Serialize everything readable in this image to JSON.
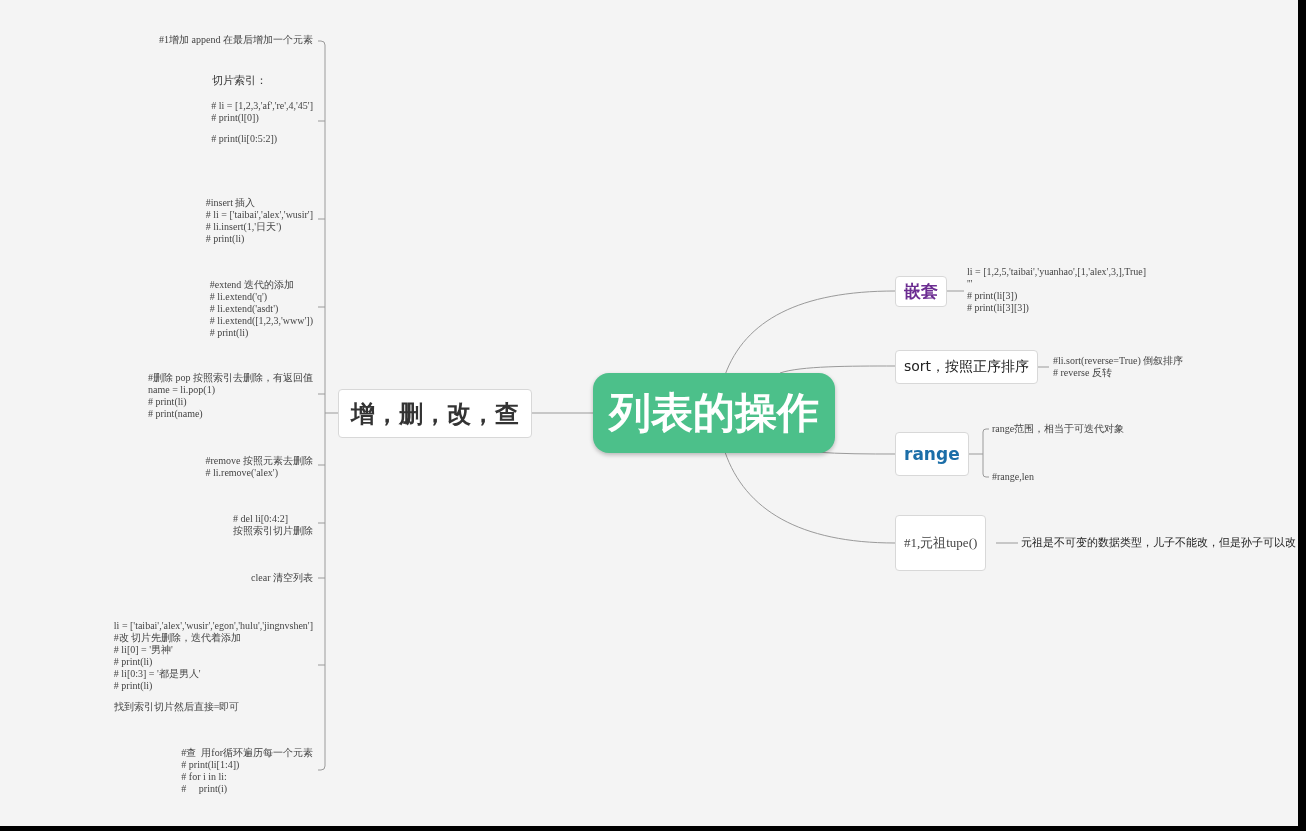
{
  "central_topic": {
    "label": "列表的操作"
  },
  "left_topic": {
    "label": "增，删，改，查",
    "notes": [
      {
        "paragraphs": [
          [
            "#1增加 append 在最后增加一个元素"
          ]
        ]
      },
      {
        "heading": "切片索引：",
        "paragraphs": [
          [
            "# li = [1,2,3,'af','re',4,'45']",
            "# print(l[0])"
          ],
          [
            "# print(li[0:5:2])"
          ]
        ]
      },
      {
        "paragraphs": [
          [
            "#insert 插入",
            "# li = ['taibai','alex','wusir']",
            "# li.insert(1,'日天')",
            "# print(li)"
          ]
        ]
      },
      {
        "paragraphs": [
          [
            "#extend 迭代的添加",
            "# li.extend('q')",
            "# li.extend('asdt')",
            "# li.extend([1,2,3,'www'])",
            "# print(li)"
          ]
        ]
      },
      {
        "paragraphs": [
          [
            "#删除 pop 按照索引去删除，有返回值",
            "name = li.pop(1)",
            "# print(li)",
            "# print(name)"
          ]
        ]
      },
      {
        "paragraphs": [
          [
            "#remove 按照元素去删除",
            "# li.remove('alex')"
          ]
        ]
      },
      {
        "paragraphs": [
          [
            "# del li[0:4:2]",
            "按照索引切片删除"
          ]
        ]
      },
      {
        "paragraphs": [
          [
            "clear 清空列表"
          ]
        ]
      },
      {
        "paragraphs": [
          [
            "li = ['taibai','alex','wusir','egon','hulu','jingnvshen']",
            "#改 切片先删除，迭代着添加",
            "# li[0] = '男神'",
            "# print(li)",
            "# li[0:3] = '都是男人'",
            "# print(li)"
          ],
          [
            "找到索引切片然后直接=即可"
          ]
        ]
      },
      {
        "paragraphs": [
          [
            "#查  用for循环遍历每一个元素",
            "# print(li[1:4])",
            "# for i in li:",
            "#     print(i)"
          ]
        ]
      }
    ]
  },
  "right_topics": [
    {
      "label": "嵌套",
      "kind": "emphasis",
      "color": "#6b2c91",
      "notes": [
        {
          "kind": "code",
          "lines": [
            "li = [1,2,5,'taibai','yuanhao',[1,'alex',3,],True]",
            "'''",
            "# print(li[3])",
            "# print(li[3][3])"
          ]
        }
      ]
    },
    {
      "label": "sort，按照正序排序",
      "kind": "plain",
      "notes": [
        {
          "kind": "code",
          "lines": [
            "#li.sort(reverse=True) 倒叙排序",
            "# reverse 反转"
          ]
        }
      ]
    },
    {
      "label": "range",
      "kind": "emphasis",
      "color": "#1b6ea8",
      "notes": [
        {
          "kind": "code",
          "lines": [
            "range范围，相当于可迭代对象"
          ]
        },
        {
          "kind": "code",
          "lines": [
            "#range,len"
          ]
        }
      ]
    },
    {
      "label": "#1,元祖tupe()",
      "kind": "code",
      "notes": [
        {
          "kind": "text",
          "lines": [
            "元祖是不可变的数据类型，儿子不能改，但是孙子可以改"
          ]
        }
      ]
    }
  ]
}
